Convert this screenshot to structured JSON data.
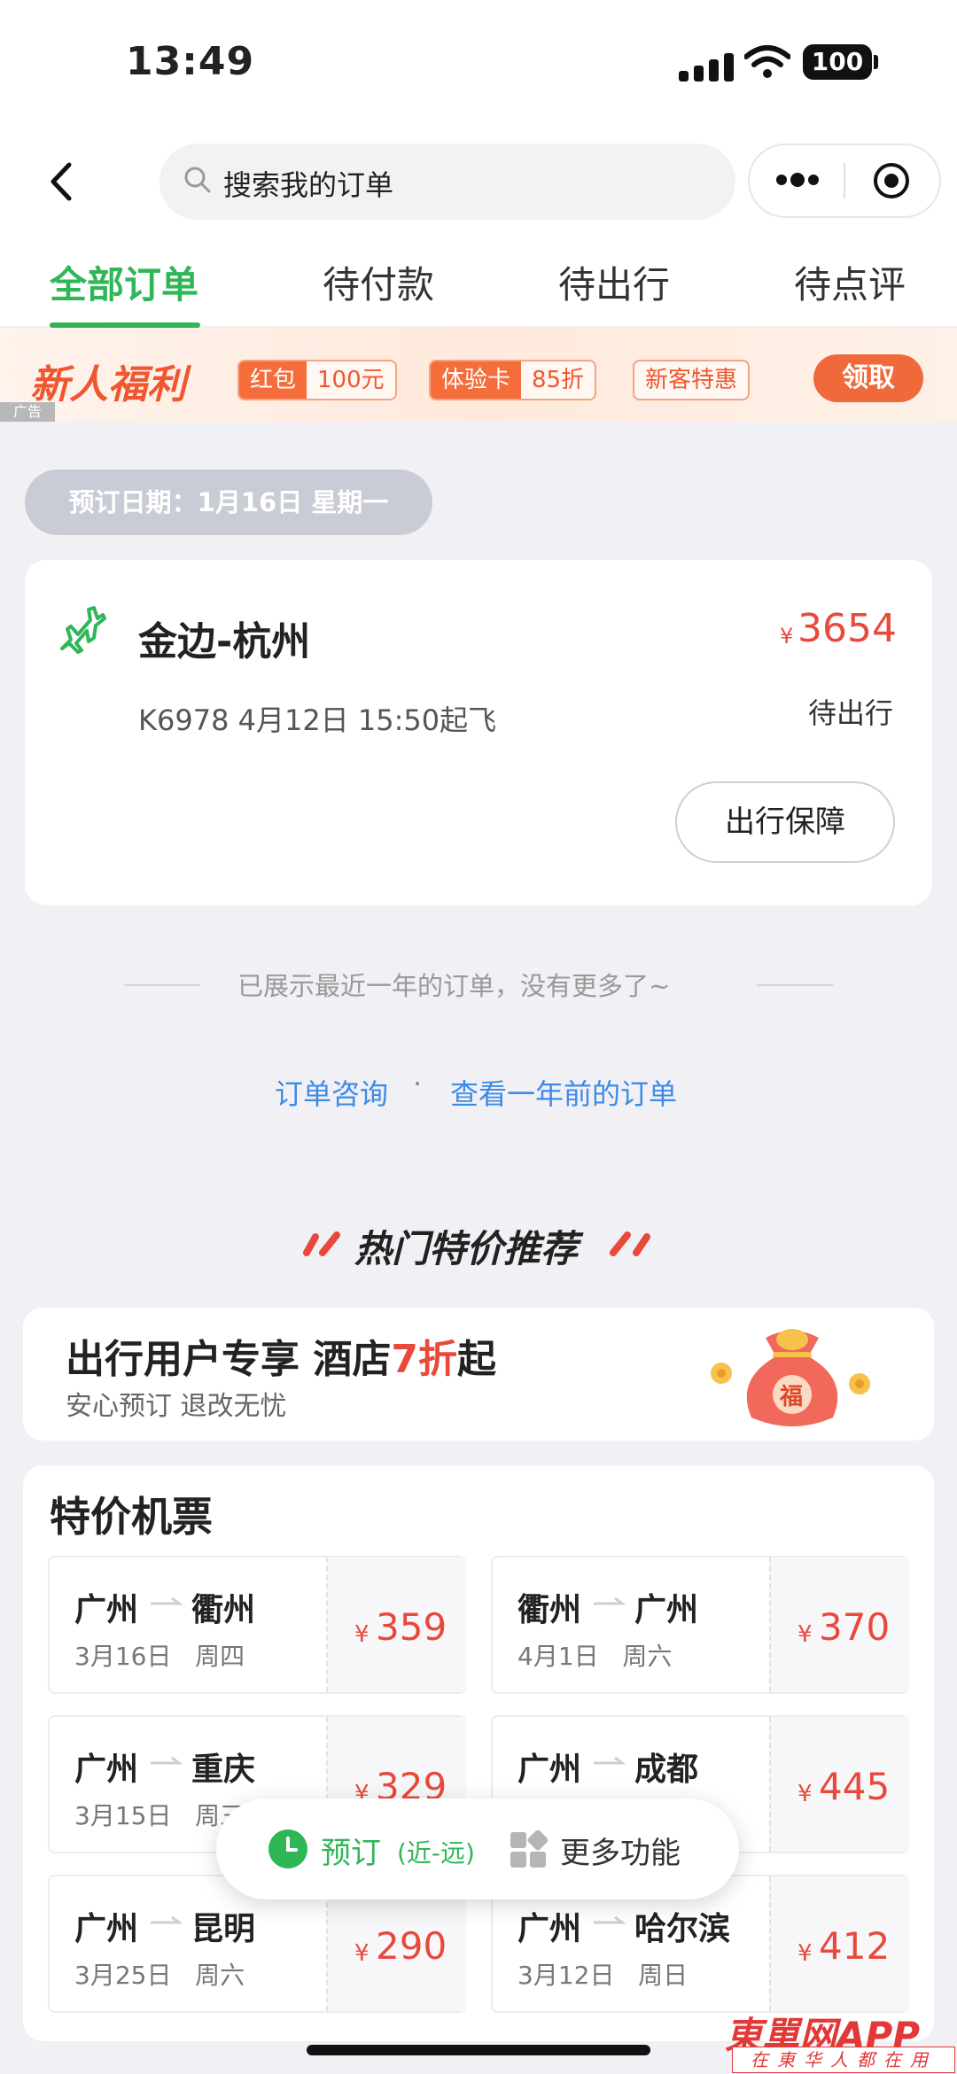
{
  "status_bar": {
    "time": "13:49",
    "battery": "100",
    "signal_icon": "cellular-signal-icon",
    "wifi_icon": "wifi-icon"
  },
  "nav": {
    "back_icon": "chevron-left-icon",
    "search_placeholder": "搜索我的订单",
    "more_icon": "more-dots-icon",
    "close_icon": "target-circle-icon"
  },
  "tabs": [
    {
      "label": "全部订单",
      "active": true
    },
    {
      "label": "待付款"
    },
    {
      "label": "待出行"
    },
    {
      "label": "待点评"
    }
  ],
  "promo": {
    "title": "新人福利",
    "chip1": {
      "a": "红包",
      "b": "100元"
    },
    "chip2": {
      "a": "体验卡",
      "b": "85折"
    },
    "chip3": "新客特惠",
    "claim": "领取",
    "ad": "广告"
  },
  "booking_date": "预订日期：1月16日 星期一",
  "order": {
    "icon": "airplane-icon",
    "route": "金边-杭州",
    "currency": "¥",
    "price": "3654",
    "detail": "K6978   4月12日 15:50起飞",
    "status": "待出行",
    "action": "出行保障"
  },
  "end_note": "已展示最近一年的订单，没有更多了~",
  "links": {
    "consult": "订单咨询",
    "dot": "·",
    "older": "查看一年前的订单"
  },
  "hot": {
    "title": "热门特价推荐",
    "hotel_title_pre": "出行用户专享 酒店",
    "hotel_title_red": "7折",
    "hotel_title_post": "起",
    "hotel_sub": "安心预订 退改无忧",
    "bag_char": "福"
  },
  "flights": {
    "title": "特价机票",
    "currency": "¥",
    "items": [
      {
        "from": "广州",
        "to": "衢州",
        "date": "3月16日",
        "weekday": "周四",
        "price": "359"
      },
      {
        "from": "衢州",
        "to": "广州",
        "date": "4月1日",
        "weekday": "周六",
        "price": "370"
      },
      {
        "from": "广州",
        "to": "重庆",
        "date": "3月15日",
        "weekday": "周三",
        "price": "329"
      },
      {
        "from": "广州",
        "to": "成都",
        "date": "",
        "weekday": "",
        "price": "445"
      },
      {
        "from": "广州",
        "to": "昆明",
        "date": "3月25日",
        "weekday": "周六",
        "price": "290"
      },
      {
        "from": "广州",
        "to": "哈尔滨",
        "date": "3月12日",
        "weekday": "周日",
        "price": "412"
      }
    ]
  },
  "fab": {
    "book": "预订",
    "book_sub": "(近-远)",
    "more": "更多功能"
  },
  "watermark": {
    "main": "東單网APP",
    "sub": "在東华人都在用"
  },
  "colors": {
    "accent_green": "#2fb657",
    "price_red": "#e8493b",
    "link_blue": "#3d8be8",
    "promo_orange": "#f0562f"
  }
}
